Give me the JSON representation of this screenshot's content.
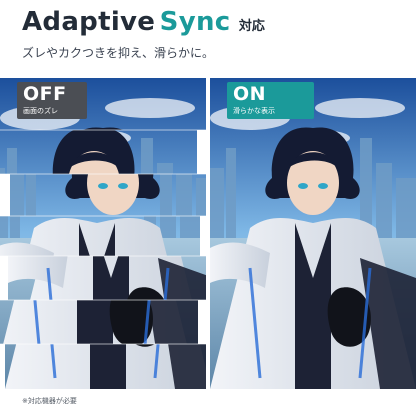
{
  "header": {
    "title_main": "Adaptive",
    "title_accent": "Sync",
    "title_suffix": "対応",
    "subtitle": "ズレやカクつきを抑え、滑らかに。"
  },
  "comparison": {
    "off": {
      "label": "OFF",
      "caption": "画面のズレ"
    },
    "on": {
      "label": "ON",
      "caption": "滑らかな表示"
    }
  },
  "footnote": "※対応機器が必要",
  "colors": {
    "accent": "#1b9a9a",
    "title": "#232c38",
    "off_badge": "#4b4e54",
    "on_badge": "#1b9a9a"
  }
}
